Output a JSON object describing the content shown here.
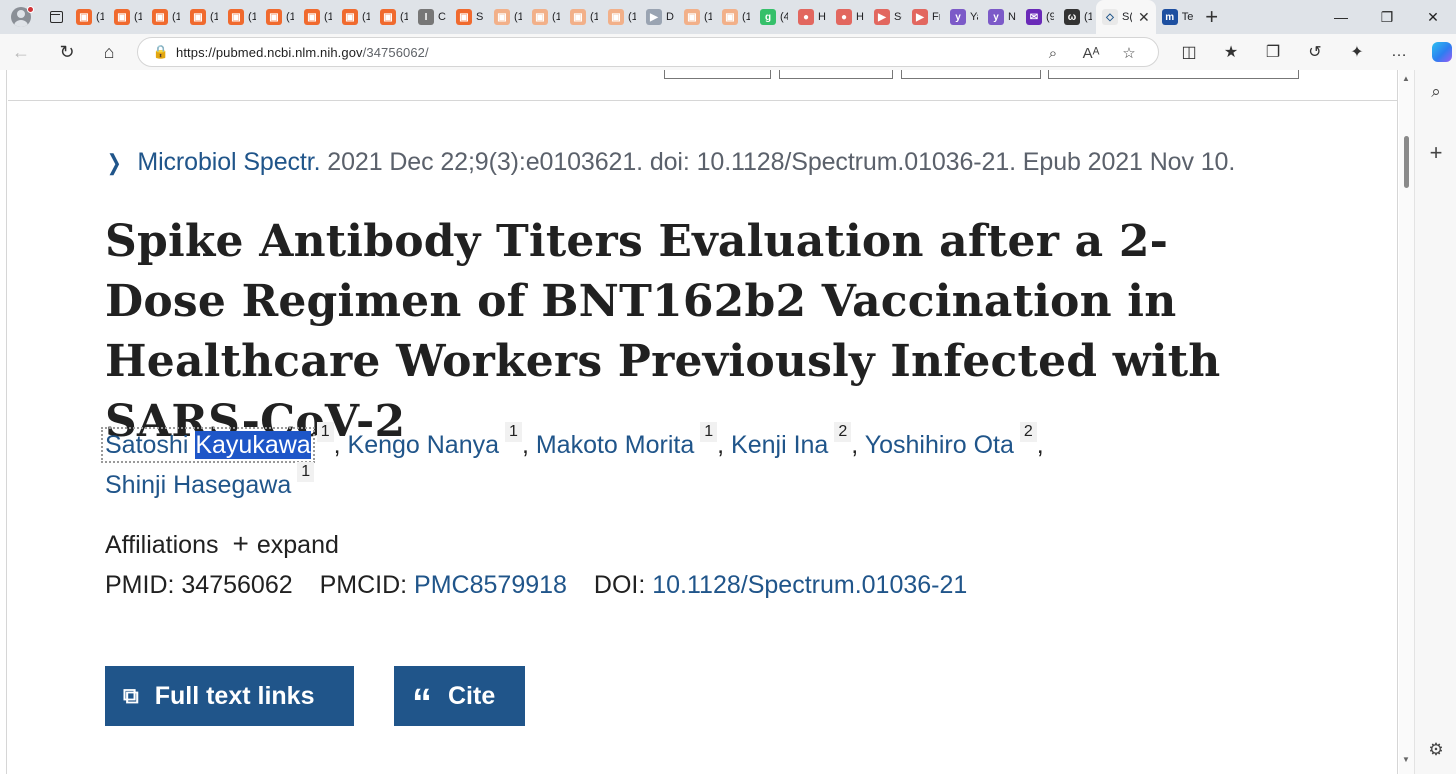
{
  "browser": {
    "tabs": [
      {
        "label": "(1",
        "color": "#f06a2e",
        "glyph": "▣"
      },
      {
        "label": "(1",
        "color": "#f06a2e",
        "glyph": "▣"
      },
      {
        "label": "(1",
        "color": "#f06a2e",
        "glyph": "▣"
      },
      {
        "label": "(1",
        "color": "#f06a2e",
        "glyph": "▣"
      },
      {
        "label": "(1",
        "color": "#f06a2e",
        "glyph": "▣"
      },
      {
        "label": "(1",
        "color": "#f06a2e",
        "glyph": "▣"
      },
      {
        "label": "(1",
        "color": "#f06a2e",
        "glyph": "▣"
      },
      {
        "label": "(1",
        "color": "#f06a2e",
        "glyph": "▣"
      },
      {
        "label": "(1",
        "color": "#f06a2e",
        "glyph": "▣"
      },
      {
        "label": "C(",
        "color": "#777777",
        "glyph": "I"
      },
      {
        "label": "Su",
        "color": "#f06a2e",
        "glyph": "▣"
      },
      {
        "label": "(1",
        "color": "#f2b089",
        "glyph": "▣"
      },
      {
        "label": "(1",
        "color": "#f2b089",
        "glyph": "▣"
      },
      {
        "label": "(1",
        "color": "#f2b089",
        "glyph": "▣"
      },
      {
        "label": "(1",
        "color": "#f2b089",
        "glyph": "▣"
      },
      {
        "label": "D(",
        "color": "#9aa4b2",
        "glyph": "▶"
      },
      {
        "label": "(1",
        "color": "#f2b089",
        "glyph": "▣"
      },
      {
        "label": "(1",
        "color": "#f2b089",
        "glyph": "▣"
      },
      {
        "label": "(4",
        "color": "#35c06a",
        "glyph": "g"
      },
      {
        "label": "H",
        "color": "#e2675f",
        "glyph": "●"
      },
      {
        "label": "H",
        "color": "#e2675f",
        "glyph": "●"
      },
      {
        "label": "Sc",
        "color": "#e2675f",
        "glyph": "▶"
      },
      {
        "label": "Fr",
        "color": "#e2675f",
        "glyph": "▶"
      },
      {
        "label": "Ya",
        "color": "#7c5ac8",
        "glyph": "y"
      },
      {
        "label": "N",
        "color": "#7c5ac8",
        "glyph": "y"
      },
      {
        "label": "(9",
        "color": "#6a2ab8",
        "glyph": "✉"
      },
      {
        "label": "(1",
        "color": "#333333",
        "glyph": "ω"
      }
    ],
    "active_tab": {
      "label": "S(",
      "close": "✕"
    },
    "next_tab": {
      "label": "Te",
      "color": "#1d4fa0",
      "glyph": "m"
    },
    "new_tab": "+",
    "window_controls": [
      "—",
      "❐",
      "✕"
    ],
    "url_host": "https://pubmed.ncbi.nlm.nih.gov",
    "url_path": "/34756062/",
    "icons": {
      "back": "←",
      "reload": "↻",
      "home": "⌂",
      "lock": "🔒",
      "zoom": "⌕",
      "read_aloud": "Aᴬ",
      "favorite": "☆",
      "split": "◫",
      "favorites": "★",
      "collections": "❐",
      "history": "↺",
      "extensions": "✦",
      "more": "…",
      "sidebar_search": "⌕",
      "sidebar_add": "+",
      "sidebar_settings": "⚙"
    }
  },
  "article": {
    "journal": "Microbiol Spectr.",
    "citation_rest": " 2021 Dec 22;9(3):e0103621. doi: 10.1128/Spectrum.01036-21. Epub 2021 Nov 10.",
    "title": "Spike Antibody Titers Evaluation after a 2-Dose Regimen of BNT162b2 Vaccination in Healthcare Workers Previously Infected with SARS-CoV-2",
    "authors": [
      {
        "first": "Satoshi",
        "last": "Kayukawa",
        "aff": "1"
      },
      {
        "name": "Kengo Nanya",
        "aff": "1"
      },
      {
        "name": "Makoto Morita",
        "aff": "1"
      },
      {
        "name": "Kenji Ina",
        "aff": "2"
      },
      {
        "name": "Yoshihiro Ota",
        "aff": "2"
      },
      {
        "name": "Shinji Hasegawa",
        "aff": "1"
      }
    ],
    "separator": ",",
    "affiliations_label": "Affiliations",
    "expand_label": "expand",
    "expand_icon": "+",
    "pmid_label": "PMID:",
    "pmid": "34756062",
    "pmcid_label": "PMCID:",
    "pmcid": "PMC8579918",
    "doi_label": "DOI:",
    "doi": "10.1128/Spectrum.01036-21",
    "full_text_label": "Full text links",
    "cite_label": "Cite",
    "cite_icon": "“",
    "external_icon": "⧉",
    "chevron": "❯"
  },
  "colors": {
    "link": "#20558a",
    "button": "#20558a",
    "selection": "#1e56c8"
  }
}
